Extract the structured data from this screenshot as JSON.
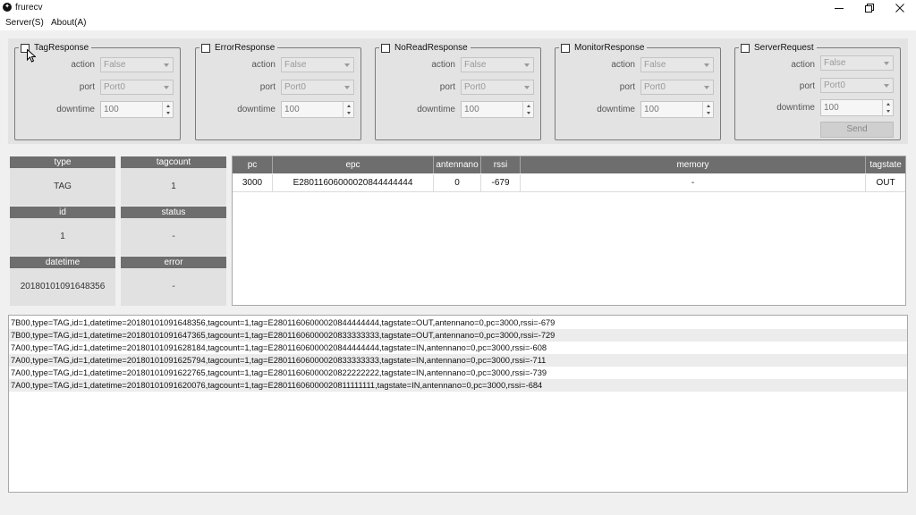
{
  "window": {
    "title": "frurecv",
    "app_icon": "app-icon-glyph",
    "icon_glyph": "✦"
  },
  "menu": {
    "items": [
      "Server(S)",
      "About(A)"
    ]
  },
  "groups": [
    {
      "title": "TagResponse",
      "action_label": "action",
      "action_value": "False",
      "port_label": "port",
      "port_value": "Port0",
      "downtime_label": "downtime",
      "downtime_value": "100"
    },
    {
      "title": "ErrorResponse",
      "action_label": "action",
      "action_value": "False",
      "port_label": "port",
      "port_value": "Port0",
      "downtime_label": "downtime",
      "downtime_value": "100"
    },
    {
      "title": "NoReadResponse",
      "action_label": "action",
      "action_value": "False",
      "port_label": "port",
      "port_value": "Port0",
      "downtime_label": "downtime",
      "downtime_value": "100"
    },
    {
      "title": "MonitorResponse",
      "action_label": "action",
      "action_value": "False",
      "port_label": "port",
      "port_value": "Port0",
      "downtime_label": "downtime",
      "downtime_value": "100"
    },
    {
      "title": "ServerRequest",
      "action_label": "action",
      "action_value": "False",
      "port_label": "port",
      "port_value": "Port0",
      "downtime_label": "downtime",
      "downtime_value": "100",
      "send_label": "Send"
    }
  ],
  "info": {
    "type_label": "type",
    "type_value": "TAG",
    "tagcount_label": "tagcount",
    "tagcount_value": "1",
    "id_label": "id",
    "id_value": "1",
    "status_label": "status",
    "status_value": "-",
    "datetime_label": "datetime",
    "datetime_value": "20180101091648356",
    "error_label": "error",
    "error_value": "-"
  },
  "table": {
    "columns": [
      "pc",
      "epc",
      "antennano",
      "rssi",
      "memory",
      "tagstate"
    ],
    "rows": [
      [
        "3000",
        "E28011606000020844444444",
        "0",
        "-679",
        "-",
        "OUT"
      ]
    ]
  },
  "log": [
    "7B00,type=TAG,id=1,datetime=20180101091648356,tagcount=1,tag=E28011606000020844444444,tagstate=OUT,antennano=0,pc=3000,rssi=-679",
    "7B00,type=TAG,id=1,datetime=20180101091647365,tagcount=1,tag=E28011606000020833333333,tagstate=OUT,antennano=0,pc=3000,rssi=-729",
    "7A00,type=TAG,id=1,datetime=20180101091628184,tagcount=1,tag=E28011606000020844444444,tagstate=IN,antennano=0,pc=3000,rssi=-608",
    "7A00,type=TAG,id=1,datetime=20180101091625794,tagcount=1,tag=E28011606000020833333333,tagstate=IN,antennano=0,pc=3000,rssi=-711",
    "7A00,type=TAG,id=1,datetime=20180101091622765,tagcount=1,tag=E28011606000020822222222,tagstate=IN,antennano=0,pc=3000,rssi=-739",
    "7A00,type=TAG,id=1,datetime=20180101091620076,tagcount=1,tag=E28011606000020811111111,tagstate=IN,antennano=0,pc=3000,rssi=-684"
  ]
}
